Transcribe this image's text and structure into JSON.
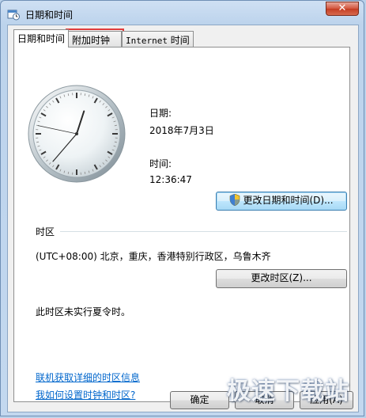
{
  "window": {
    "title": "日期和时间",
    "close_glyph": "✕"
  },
  "tabs": [
    {
      "label": "日期和时间",
      "active": true
    },
    {
      "label": "附加时钟",
      "active": false
    },
    {
      "label_prefix": "Internet",
      "label_suffix": " 时间",
      "active": false
    }
  ],
  "datetime": {
    "date_label": "日期:",
    "date_value": "2018年7月3日",
    "time_label": "时间:",
    "time_value": "12:36:47",
    "change_button": "更改日期和时间(D)..."
  },
  "clock": {
    "hours": 12,
    "minutes": 36,
    "seconds": 47
  },
  "timezone": {
    "section_label": "时区",
    "value": "(UTC+08:00) 北京，重庆，香港特别行政区，乌鲁木齐",
    "change_button": "更改时区(Z)...",
    "dst_note": "此时区未实行夏令时。"
  },
  "links": {
    "timezone_info": "联机获取详细的时区信息",
    "how_to_set": "我如何设置时钟和时区?"
  },
  "footer": {
    "ok": "确定",
    "cancel": "取消",
    "apply": "应用(A)"
  },
  "watermark": "极速下载站"
}
